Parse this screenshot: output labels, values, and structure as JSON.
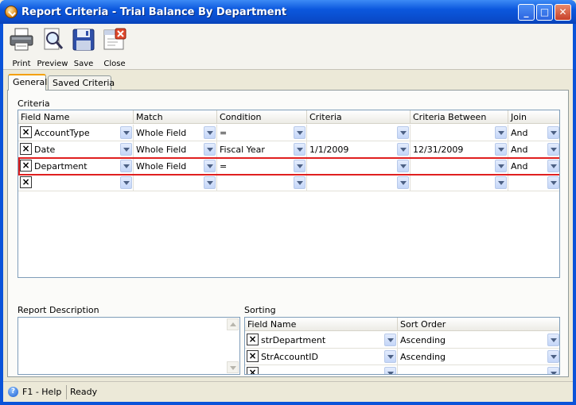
{
  "window": {
    "title": "Report Criteria - Trial Balance By Department",
    "min_glyph": "_",
    "max_glyph": "□",
    "close_glyph": "✕"
  },
  "toolbar": {
    "print_label": "Print",
    "preview_label": "Preview",
    "save_label": "Save",
    "close_label": "Close"
  },
  "tabs": {
    "general": "General",
    "saved_criteria": "Saved Criteria"
  },
  "criteria": {
    "group_label": "Criteria",
    "headers": [
      "Field Name",
      "Match",
      "Condition",
      "Criteria",
      "Criteria Between",
      "Join"
    ],
    "rows": [
      [
        "AccountType",
        "Whole Field",
        "=",
        "",
        "",
        "And"
      ],
      [
        "Date",
        "Whole Field",
        "Fiscal Year",
        "1/1/2009",
        "12/31/2009",
        "And"
      ],
      [
        "Department",
        "Whole Field",
        "=",
        "",
        "",
        "And"
      ],
      [
        "",
        "",
        "",
        "",
        "",
        ""
      ]
    ],
    "selected_row": 2
  },
  "report_description": {
    "label": "Report Description",
    "value": ""
  },
  "sorting": {
    "group_label": "Sorting",
    "headers": [
      "Field Name",
      "Sort Order"
    ],
    "rows": [
      [
        "strDepartment",
        "Ascending"
      ],
      [
        "StrAccountID",
        "Ascending"
      ],
      [
        "",
        ""
      ]
    ]
  },
  "status": {
    "help": "F1 - Help",
    "state": "Ready"
  },
  "colors": {
    "title_bar": "#0b57dd",
    "selected_row_outline": "#e02020",
    "window_bg": "#ece9d8"
  },
  "icons": {
    "app": "app-check-icon",
    "print": "printer-icon",
    "preview": "magnifier-document-icon",
    "save": "floppy-disk-icon",
    "close": "close-document-icon",
    "help": "help-question-icon",
    "delete_row": "x-box-icon",
    "dropdown": "chevron-down-icon"
  }
}
